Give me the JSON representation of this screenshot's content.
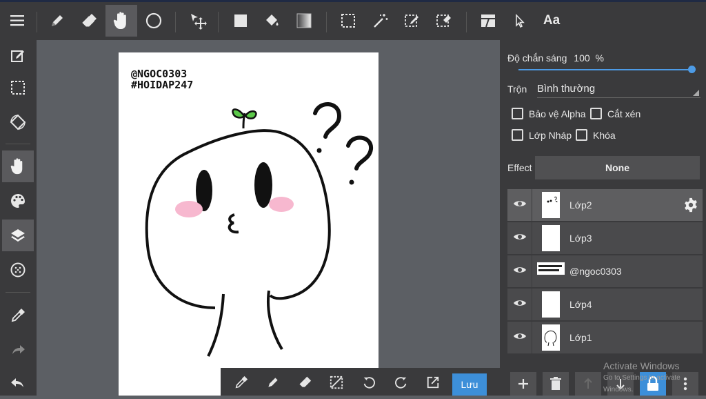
{
  "toolbar": {
    "font_label": "Aa"
  },
  "canvas": {
    "signature_line1": "@NGOC0303",
    "signature_line2": "#HOIDAP247"
  },
  "bottom_toolbar": {
    "save_label": "Lưu"
  },
  "layer_panel": {
    "opacity_label": "Độ chắn sáng",
    "opacity_value": "100",
    "opacity_unit": "%",
    "opacity_fraction": 1.0,
    "blend_label": "Trộn",
    "blend_value": "Bình thường",
    "checkboxes": {
      "alpha_protect": "Bảo vệ Alpha",
      "clipping": "Cắt xén",
      "draft_layer": "Lớp Nháp",
      "lock": "Khóa"
    },
    "effect_label": "Effect",
    "effect_value": "None",
    "layers": [
      {
        "name": "Lớp2",
        "selected": true
      },
      {
        "name": "Lớp3",
        "selected": false
      },
      {
        "name": "@ngoc0303",
        "selected": false
      },
      {
        "name": "Lớp4",
        "selected": false
      },
      {
        "name": "Lớp1",
        "selected": false
      }
    ]
  },
  "watermark": {
    "line1": "Activate Windows",
    "line2": "Go to Settings to activate Windows."
  },
  "colors": {
    "accent": "#3d8fd9",
    "toolbar_bg": "#3a3a3c",
    "canvas_bg": "#5c5f64",
    "sprout_green": "#5cc94a",
    "blush_pink": "#f7b8cf"
  }
}
